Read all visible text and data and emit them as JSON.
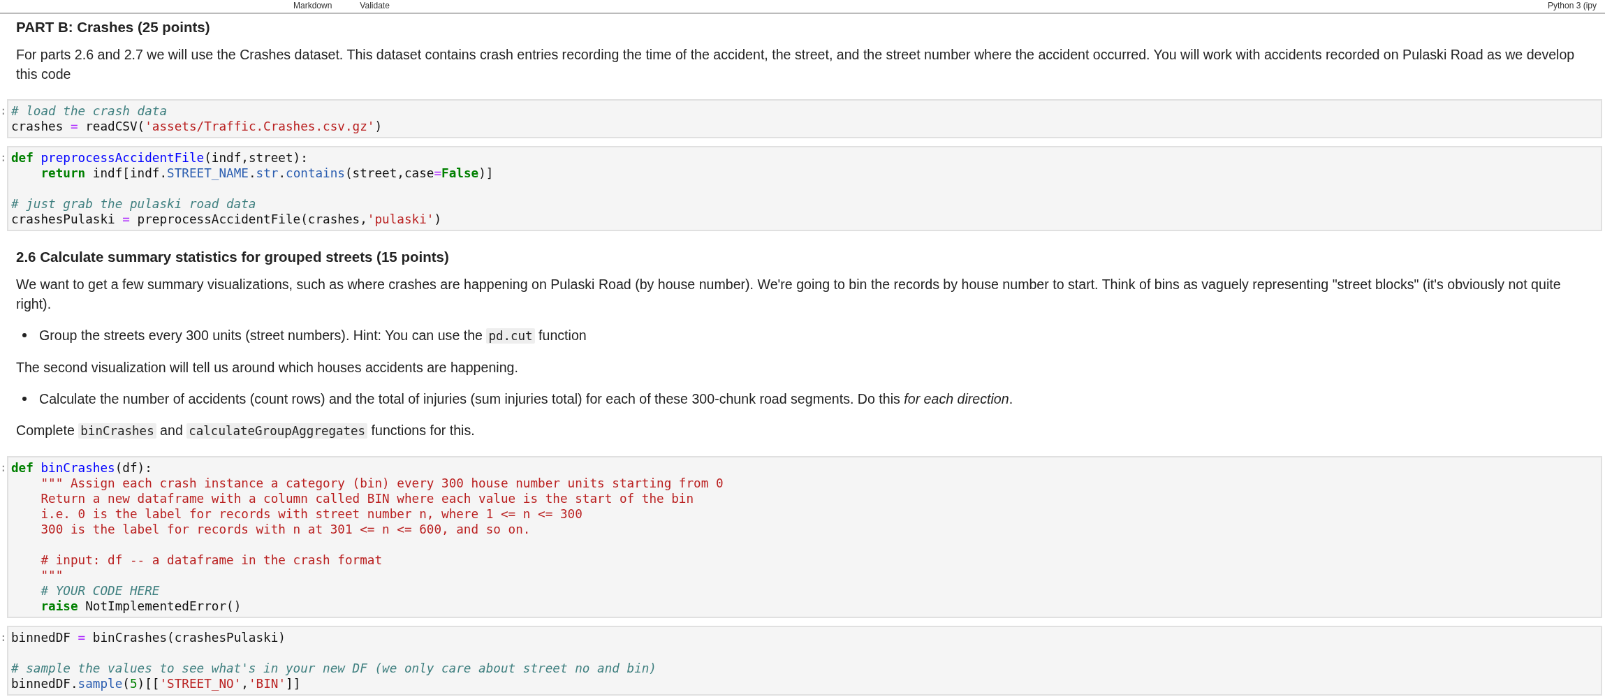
{
  "toolbar": {
    "cell_type": "Markdown",
    "validate": "Validate",
    "kernel": "Python 3 (ipy"
  },
  "cells": [
    {
      "kind": "title",
      "text": "PART B: Crashes (25 points)"
    },
    {
      "kind": "paragraph",
      "segments": [
        {
          "kind": "text",
          "text": "For parts 2.6 and 2.7 we will use the Crashes dataset. This dataset contains crash entries recording the time of the accident, the street, and the street number where the accident occurred. You will work with accidents recorded on Pulaski Road as we develop this code"
        }
      ]
    },
    {
      "kind": "code",
      "prompt": ":",
      "blocks": [
        [
          {
            "indented": false,
            "tokens": [
              {
                "kind": "comment",
                "text": "# load the crash data"
              }
            ]
          },
          {
            "indented": false,
            "tokens": [
              {
                "kind": "plain",
                "text": "crashes "
              },
              {
                "kind": "op",
                "text": "="
              },
              {
                "kind": "plain",
                "text": " readCSV("
              },
              {
                "kind": "string",
                "text": "'assets/Traffic.Crashes.csv.gz'"
              },
              {
                "kind": "plain",
                "text": ")"
              }
            ]
          }
        ]
      ]
    },
    {
      "kind": "code",
      "prompt": ":",
      "blocks": [
        [
          {
            "indented": false,
            "tokens": [
              {
                "kind": "keyword",
                "text": "def"
              },
              {
                "kind": "defname",
                "text": " preprocessAccidentFile"
              },
              {
                "kind": "plain",
                "text": "(indf,street):"
              }
            ]
          },
          {
            "indented": true,
            "tokens": [
              {
                "kind": "keyword",
                "text": "return"
              },
              {
                "kind": "plain",
                "text": " indf[indf."
              },
              {
                "kind": "attr",
                "text": "STREET_NAME"
              },
              {
                "kind": "plain",
                "text": "."
              },
              {
                "kind": "attr",
                "text": "str"
              },
              {
                "kind": "plain",
                "text": "."
              },
              {
                "kind": "attr",
                "text": "contains"
              },
              {
                "kind": "plain",
                "text": "(street,case"
              },
              {
                "kind": "op",
                "text": "="
              },
              {
                "kind": "keyword",
                "text": "False"
              },
              {
                "kind": "plain",
                "text": ")]"
              }
            ]
          }
        ],
        [
          {
            "indented": false,
            "tokens": [
              {
                "kind": "comment",
                "text": "# just grab the pulaski road data"
              }
            ]
          },
          {
            "indented": false,
            "tokens": [
              {
                "kind": "plain",
                "text": "crashesPulaski "
              },
              {
                "kind": "op",
                "text": "="
              },
              {
                "kind": "plain",
                "text": " preprocessAccidentFile(crashes,"
              },
              {
                "kind": "string",
                "text": "'pulaski'"
              },
              {
                "kind": "plain",
                "text": ")"
              }
            ]
          }
        ]
      ]
    },
    {
      "kind": "subheading",
      "text": "2.6 Calculate summary statistics for grouped streets (15 points)"
    },
    {
      "kind": "paragraph",
      "segments": [
        {
          "kind": "text",
          "text": "We want to get a few summary visualizations, such as where crashes are happening on Pulaski Road (by house number). We're going to bin the records by house number to start. Think of bins as vaguely representing \"street blocks\" (it's obviously not quite right)."
        }
      ]
    },
    {
      "kind": "bullet",
      "segments": [
        {
          "kind": "text",
          "text": "Group the streets every 300 units (street numbers). Hint: You can use the "
        },
        {
          "kind": "code",
          "text": "pd.cut"
        },
        {
          "kind": "text",
          "text": " function"
        }
      ]
    },
    {
      "kind": "paragraph",
      "segments": [
        {
          "kind": "text",
          "text": "The second visualization will tell us around which houses accidents are happening."
        }
      ]
    },
    {
      "kind": "bullet",
      "segments": [
        {
          "kind": "text",
          "text": "Calculate the number of accidents (count rows) and the total of injuries (sum injuries total) for each of these 300-chunk road segments. Do this *for each direction*."
        }
      ]
    },
    {
      "kind": "paragraph",
      "segments": [
        {
          "kind": "text",
          "text": "Complete "
        },
        {
          "kind": "code",
          "text": "binCrashes"
        },
        {
          "kind": "text",
          "text": " and "
        },
        {
          "kind": "code",
          "text": "calculateGroupAggregates"
        },
        {
          "kind": "text",
          "text": " functions for this."
        }
      ]
    },
    {
      "kind": "code",
      "prompt": ":",
      "blocks": [
        [
          {
            "indented": false,
            "tokens": [
              {
                "kind": "keyword",
                "text": "def"
              },
              {
                "kind": "defname",
                "text": " binCrashes"
              },
              {
                "kind": "plain",
                "text": "(df):"
              }
            ]
          },
          {
            "indented": true,
            "tokens": [
              {
                "kind": "string",
                "text": "\"\"\" Assign each crash instance a category (bin) every 300 house number units starting from 0"
              }
            ]
          },
          {
            "indented": true,
            "tokens": [
              {
                "kind": "string",
                "text": "Return a new dataframe with a column called BIN where each value is the start of the bin"
              }
            ]
          },
          {
            "indented": true,
            "tokens": [
              {
                "kind": "string",
                "text": "i.e. 0 is the label for records with street number n, where 1 <= n <= 300"
              }
            ]
          },
          {
            "indented": true,
            "tokens": [
              {
                "kind": "string",
                "text": "300 is the label for records with n at 301 <= n <= 600, and so on."
              }
            ]
          }
        ],
        [
          {
            "indented": true,
            "tokens": [
              {
                "kind": "string",
                "text": "# input: df -- a dataframe in the crash format"
              }
            ]
          },
          {
            "indented": true,
            "tokens": [
              {
                "kind": "string",
                "text": "\"\"\""
              }
            ]
          },
          {
            "indented": true,
            "tokens": [
              {
                "kind": "comment",
                "text": "# YOUR CODE HERE"
              }
            ]
          },
          {
            "indented": true,
            "tokens": [
              {
                "kind": "keyword",
                "text": "raise"
              },
              {
                "kind": "plain",
                "text": " NotImplementedError()"
              }
            ]
          }
        ]
      ]
    },
    {
      "kind": "code",
      "prompt": ":",
      "blocks": [
        [
          {
            "indented": false,
            "tokens": [
              {
                "kind": "plain",
                "text": "binnedDF "
              },
              {
                "kind": "op",
                "text": "="
              },
              {
                "kind": "plain",
                "text": " binCrashes(crashesPulaski)"
              }
            ]
          }
        ],
        [
          {
            "indented": false,
            "tokens": [
              {
                "kind": "comment",
                "text": "# sample the values to see what's in your new DF (we only care about street no and bin)"
              }
            ]
          },
          {
            "indented": false,
            "tokens": [
              {
                "kind": "plain",
                "text": "binnedDF."
              },
              {
                "kind": "attr",
                "text": "sample"
              },
              {
                "kind": "plain",
                "text": "("
              },
              {
                "kind": "number",
                "text": "5"
              },
              {
                "kind": "plain",
                "text": ")[["
              },
              {
                "kind": "string",
                "text": "'STREET_NO'"
              },
              {
                "kind": "plain",
                "text": ","
              },
              {
                "kind": "string",
                "text": "'BIN'"
              },
              {
                "kind": "plain",
                "text": "]]"
              }
            ]
          }
        ]
      ]
    }
  ]
}
